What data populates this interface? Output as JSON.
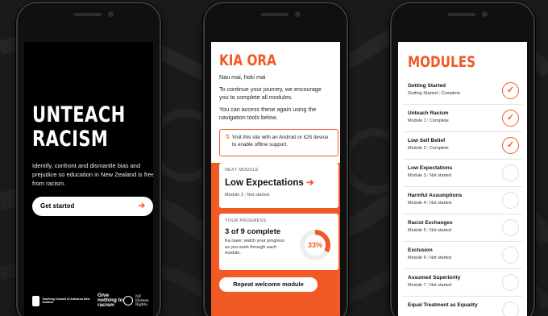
{
  "colors": {
    "accent": "#f15a24",
    "background": "#1b1b1b"
  },
  "welcome": {
    "headline_line1": "UNTEACH",
    "headline_line2": "RACISM",
    "subtitle": "Identify, confront and dismantle bias and prejudice so education in New Zealand is free from racism.",
    "start_label": "Get started",
    "start_icon": "arrow-right-icon",
    "logos": [
      {
        "name": "teaching-council-logo",
        "text": "Teaching Council of Aotearoa New Zealand"
      },
      {
        "name": "give-nothing-to-racism-logo",
        "text": "Give nothing to racism"
      },
      {
        "name": "nz-human-rights-logo",
        "text": "NZ Human Rights."
      }
    ]
  },
  "home": {
    "title": "KIA ORA",
    "greeting": "Nau mai, hoki mai",
    "intro": "To continue your journey, we encourage you to complete all modules.",
    "access": "You can access these again using the navigation tools below.",
    "notice": "Visit this site with an Android or iOS device to enable offline support.",
    "next_module": {
      "label": "NEXT MODULE",
      "name": "Low Expectations",
      "module": "Module 3",
      "status": "Not started"
    },
    "progress": {
      "label": "YOUR PROGRESS",
      "summary": "3 of 9 complete",
      "description": "Ka rawe; watch your progress as you work through each module.",
      "percent_label": "33%",
      "percent": 33
    },
    "repeat_label": "Repeat welcome module"
  },
  "modules": {
    "title": "MODULES",
    "items": [
      {
        "name": "Getting Started",
        "module": "Getting Started",
        "status": "Complete",
        "done": true
      },
      {
        "name": "Unteach Racism",
        "module": "Module 1",
        "status": "Complete",
        "done": true
      },
      {
        "name": "Low Self Belief",
        "module": "Module 2",
        "status": "Complete",
        "done": true
      },
      {
        "name": "Low Expectations",
        "module": "Module 3",
        "status": "Not started",
        "done": false
      },
      {
        "name": "Harmful Assumptions",
        "module": "Module 4",
        "status": "Not started",
        "done": false
      },
      {
        "name": "Racist Exchanges",
        "module": "Module 5",
        "status": "Not started",
        "done": false
      },
      {
        "name": "Exclusion",
        "module": "Module 6",
        "status": "Not started",
        "done": false
      },
      {
        "name": "Assumed Superiority",
        "module": "Module 7",
        "status": "Not started",
        "done": false
      },
      {
        "name": "Equal Treatment as Equality",
        "module": "",
        "status": "",
        "done": false
      }
    ]
  }
}
